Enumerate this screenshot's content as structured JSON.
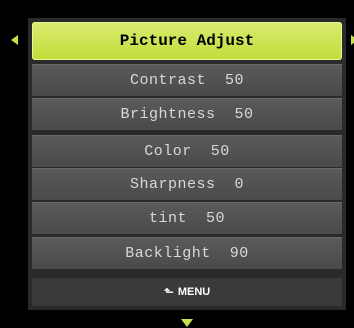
{
  "header": {
    "title": "Picture Adjust"
  },
  "items": [
    {
      "label": "Contrast",
      "value": "50"
    },
    {
      "label": "Brightness",
      "value": "50"
    },
    {
      "label": "Color",
      "value": "50"
    },
    {
      "label": "Sharpness",
      "value": "0"
    },
    {
      "label": "tint",
      "value": "50"
    },
    {
      "label": "Backlight",
      "value": "90"
    }
  ],
  "footer": {
    "icon": "return-icon",
    "label": "MENU"
  },
  "colors": {
    "accent": "#c8e04a",
    "item_bg": "#505050",
    "panel_bg": "#2a2a2a"
  }
}
